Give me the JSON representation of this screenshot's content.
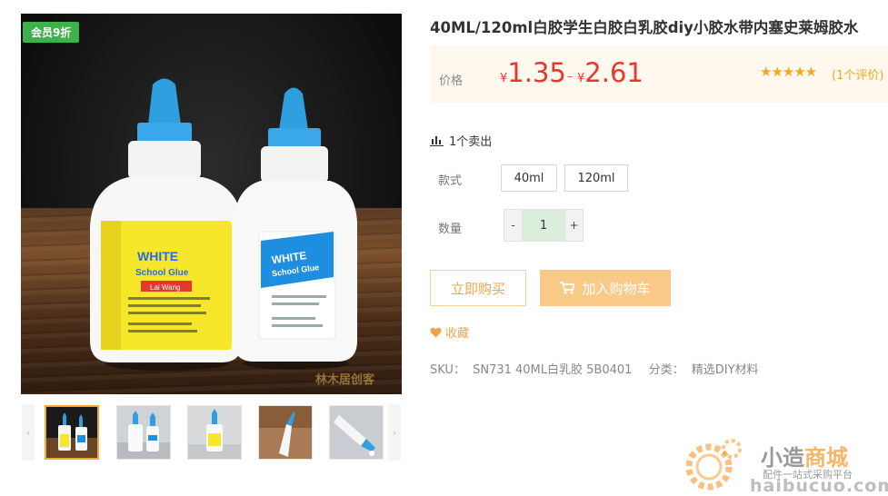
{
  "gallery": {
    "badge": "会员9折",
    "watermark": "林木居创客",
    "prev_arrow": "‹",
    "next_arrow": "›",
    "thumbnails": [
      "thumb-1",
      "thumb-2",
      "thumb-3",
      "thumb-4",
      "thumb-5"
    ],
    "bottle_label_text": "WHITE",
    "bottle_label_sub": "School Glue",
    "bottle_brand": "Lai Wang"
  },
  "product": {
    "title": "40ML/120ml白胶学生白胶白乳胶diy小胶水带内塞史莱姆胶水",
    "price_label": "价格",
    "currency": "¥",
    "price_low": "1.35",
    "price_sep": "–",
    "price_high": "2.61",
    "rating_stars": 5,
    "stars_text": "★★★★★",
    "review_text": "(1个评价)",
    "sold_text": "1个卖出",
    "style_label": "款式",
    "styles": [
      "40ml",
      "120ml"
    ],
    "qty_label": "数量",
    "qty_minus": "-",
    "qty_value": "1",
    "qty_plus": "+",
    "buy_now": "立即购买",
    "add_to_cart": "加入购物车",
    "favorite": "收藏",
    "sku_label": "SKU：",
    "sku_value": "SN731 40ML白乳胶 5B0401",
    "category_label": "分类：",
    "category_value": "精选DIY材料"
  },
  "site_watermark": {
    "name_a": "小造",
    "name_b": "商城",
    "slogan": "配件一站式采购平台",
    "domain": "haibucuo.com"
  },
  "colors": {
    "price": "#e8362d",
    "accent": "#f0a54a",
    "star": "#f5a623",
    "badge": "#3cb34a"
  }
}
